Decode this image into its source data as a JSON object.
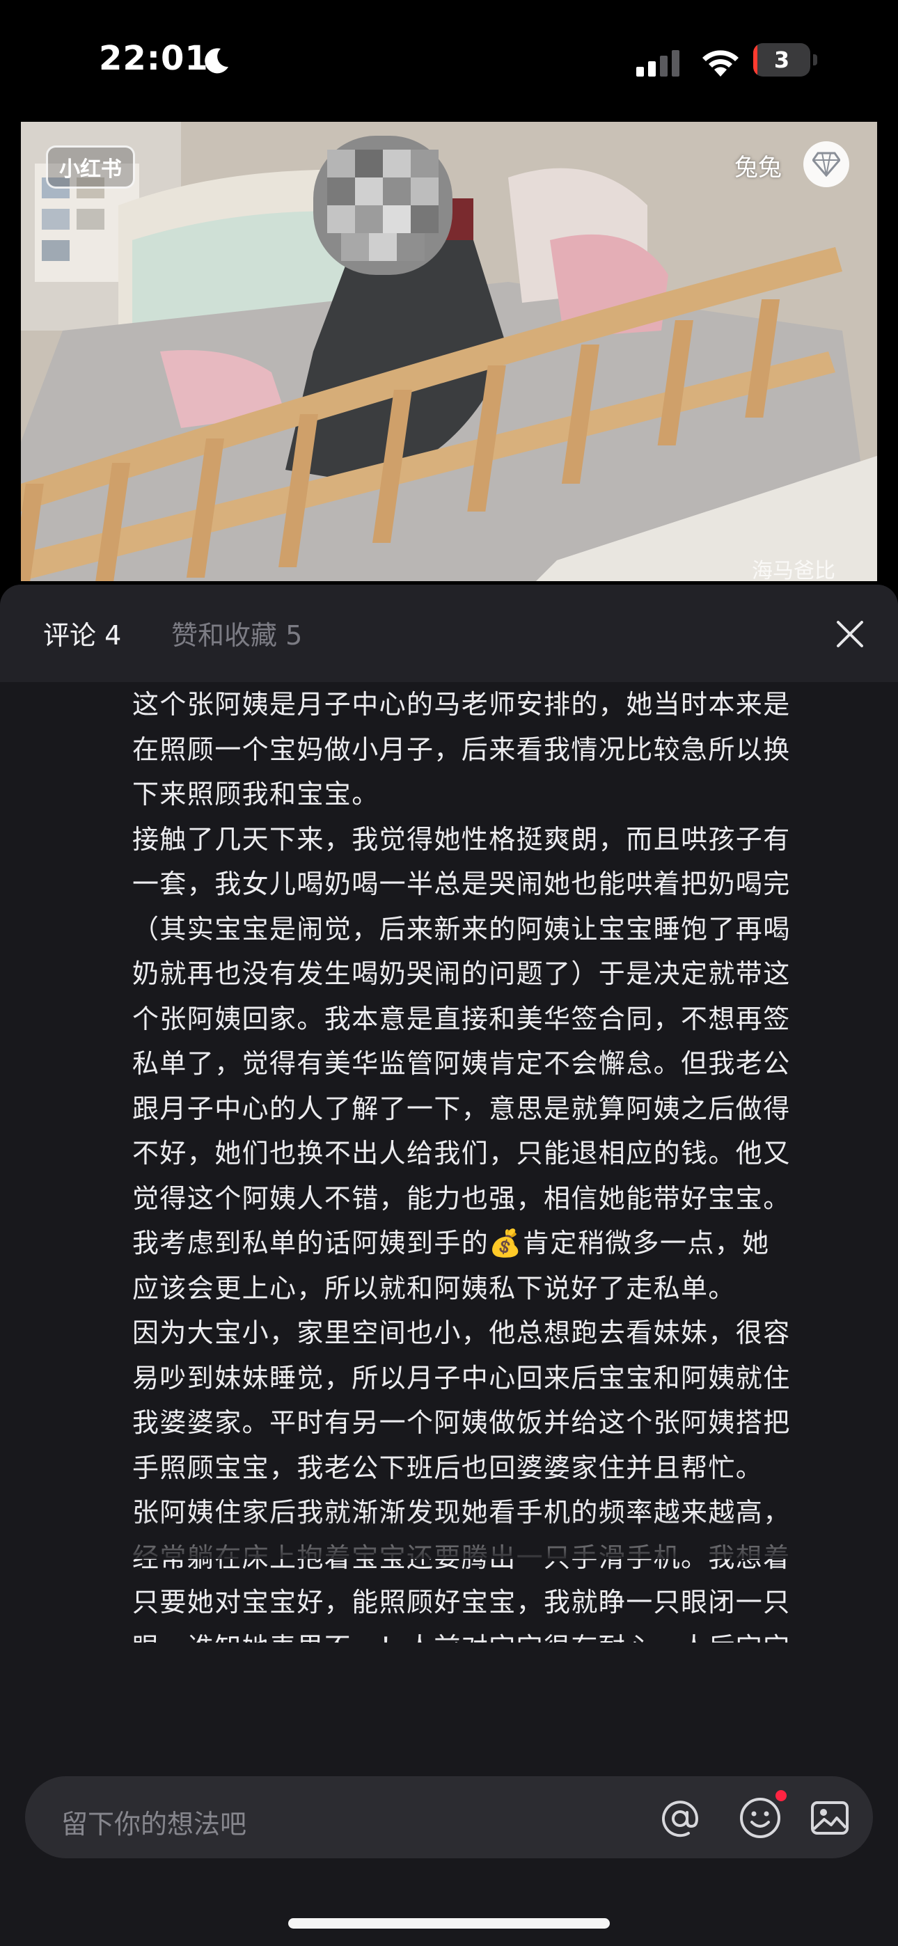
{
  "status_bar": {
    "time": "22:01",
    "battery_level": 3,
    "battery_color": "#ff3b30"
  },
  "media": {
    "logo_text": "小红书",
    "author": "兔兔",
    "corner_text": "海马爸比"
  },
  "panel": {
    "tab_comments": "评论 4",
    "tab_likes": "赞和收藏 5",
    "comment_text": "这个张阿姨是月子中心的马老师安排的，她当时本来是\n在照顾一个宝妈做小月子，后来看我情况比较急所以换\n下来照顾我和宝宝。\n接触了几天下来，我觉得她性格挺爽朗，而且哄孩子有\n一套，我女儿喝奶喝一半总是哭闹她也能哄着把奶喝完\n（其实宝宝是闹觉，后来新来的阿姨让宝宝睡饱了再喝\n奶就再也没有发生喝奶哭闹的问题了）于是决定就带这\n个张阿姨回家。我本意是直接和美华签合同，不想再签\n私单了，觉得有美华监管阿姨肯定不会懈怠。但我老公\n跟月子中心的人了解了一下，意思是就算阿姨之后做得\n不好，她们也换不出人给我们，只能退相应的钱。他又\n觉得这个阿姨人不错，能力也强，相信她能带好宝宝。\n我考虑到私单的话阿姨到手的💰肯定稍微多一点，她\n应该会更上心，所以就和阿姨私下说好了走私单。\n因为大宝小，家里空间也小，他总想跑去看妹妹，很容\n易吵到妹妹睡觉，所以月子中心回来后宝宝和阿姨就住\n我婆婆家。平时有另一个阿姨做饭并给这个张阿姨搭把\n手照顾宝宝，我老公下班后也回婆婆家住并且帮忙。\n张阿姨住家后我就渐渐发现她看手机的频率越来越高，\n经常躺在床上抱着宝宝还要腾出一只手滑手机。我想着\n只要她对宝宝好，能照顾好宝宝，我就睁一只眼闭一只\n眼。谁知她表里不一！人前对宝宝很有耐心，人后宝宝\n哭闹得厉害了会不耐烦，手上动作很大！（我会再发一\n个视频）最后决定辞退她是因为我看到她在我女儿睡"
  },
  "input": {
    "placeholder": "留下你的想法吧"
  },
  "icons": {
    "moon": "moon-icon",
    "signal": "cellular-signal-icon",
    "wifi": "wifi-icon",
    "close": "close-icon",
    "at": "at-icon",
    "emoji": "emoji-icon",
    "image": "image-icon",
    "diamond": "diamond-icon"
  },
  "colors": {
    "accent_red": "#ff2442",
    "panel_bg": "#18181c"
  }
}
